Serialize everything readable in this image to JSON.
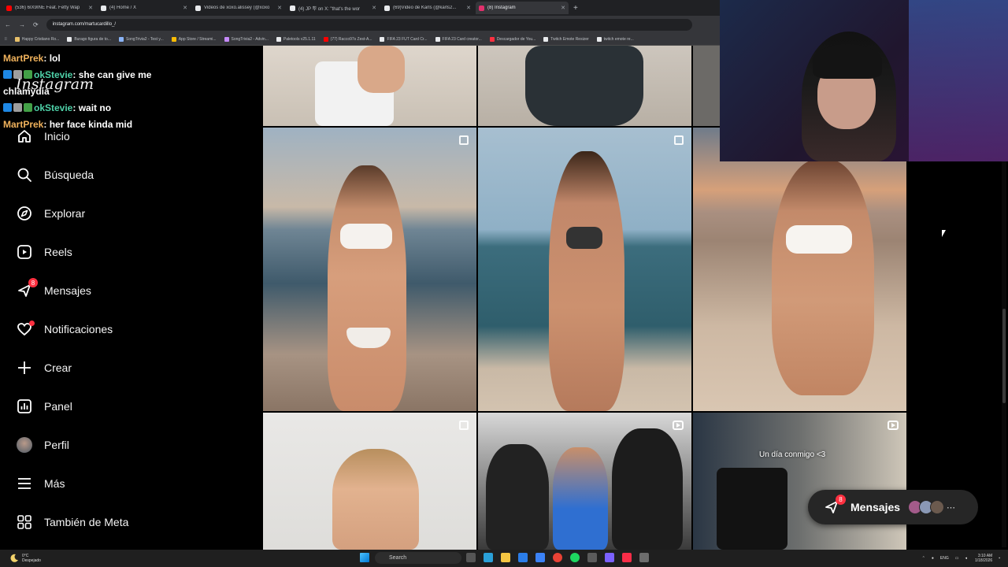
{
  "browser": {
    "tabs": [
      {
        "title": "(536) 6IX9INE Feat. Fetty Wap",
        "color": "#ff0000",
        "active": false
      },
      {
        "title": "(4) Home / X",
        "color": "#e8eaed",
        "active": false
      },
      {
        "title": "Videos de xoxo.alissey (@xoxo",
        "color": "#e8eaed",
        "active": false
      },
      {
        "title": "(4) JP 뿌 on X: \"that's the wor",
        "color": "#e8eaed",
        "active": false
      },
      {
        "title": "(69)Video de Karls (@karls2...",
        "color": "#e8eaed",
        "active": false
      },
      {
        "title": "(8) Instagram",
        "color": "#e1306c",
        "active": true
      }
    ],
    "new_tab": "+",
    "url": "instagram.com/martucardillo_/",
    "bookmarks": [
      {
        "label": "Happy Cristiano Ro...",
        "color": "#e8c06a"
      },
      {
        "label": "Burago figura de to...",
        "color": "#e8eaed"
      },
      {
        "label": "SongTrivia2 - Test y...",
        "color": "#8ab4f8"
      },
      {
        "label": "App Store / Streami...",
        "color": "#fbbc04"
      },
      {
        "label": "SongTrivia2 - Advin...",
        "color": "#c58af9"
      },
      {
        "label": "Paletools v25.1.11",
        "color": "#e8eaed"
      },
      {
        "label": "(77) Racco97s Zest-A...",
        "color": "#ff0000"
      },
      {
        "label": "FIFA 23 FUT Card Cr...",
        "color": "#e8eaed"
      },
      {
        "label": "FIFA 23 Card creator...",
        "color": "#e8eaed"
      },
      {
        "label": "Descargador de You...",
        "color": "#ff3040"
      },
      {
        "label": "Twitch Emote Resizer",
        "color": "#e8eaed"
      },
      {
        "label": "twitch emote re...",
        "color": "#e8eaed"
      }
    ]
  },
  "sidebar": {
    "logo": "Instagram",
    "items": [
      {
        "label": "Inicio",
        "icon": "home-icon"
      },
      {
        "label": "Búsqueda",
        "icon": "search-icon"
      },
      {
        "label": "Explorar",
        "icon": "compass-icon"
      },
      {
        "label": "Reels",
        "icon": "reels-icon"
      },
      {
        "label": "Mensajes",
        "icon": "messenger-icon",
        "badge": "8"
      },
      {
        "label": "Notificaciones",
        "icon": "heart-icon"
      },
      {
        "label": "Crear",
        "icon": "plus-icon"
      },
      {
        "label": "Panel",
        "icon": "chart-icon"
      },
      {
        "label": "Perfil",
        "icon": "avatar"
      },
      {
        "label": "Más",
        "icon": "menu-icon"
      },
      {
        "label": "También de Meta",
        "icon": "meta-grid-icon"
      }
    ]
  },
  "chat": [
    {
      "user": "MartPrek",
      "sep": ": ",
      "msg": "lol",
      "user_color": "#f0b25c"
    },
    {
      "user": "okStevie",
      "sep": ": ",
      "msg": "she can give me",
      "user_color": "#4ed1a8"
    },
    {
      "user": "",
      "sep": "",
      "msg": "chlamydia",
      "user_color": "#4ed1a8"
    },
    {
      "user": "okStevie",
      "sep": ": ",
      "msg": "wait no",
      "user_color": "#4ed1a8"
    },
    {
      "user": "MartPrek",
      "sep": ": ",
      "msg": "her face kinda mid",
      "user_color": "#f0b25c"
    }
  ],
  "grid": {
    "reel_caption": "Un día conmigo <3"
  },
  "messages_pill": {
    "label": "Mensajes",
    "badge": "8"
  },
  "taskbar": {
    "weather_temp": "0°C",
    "weather_desc": "Despejado",
    "search": "Search",
    "lang": "ENG",
    "time": "3:10 AM",
    "date": "1/18/2026"
  }
}
